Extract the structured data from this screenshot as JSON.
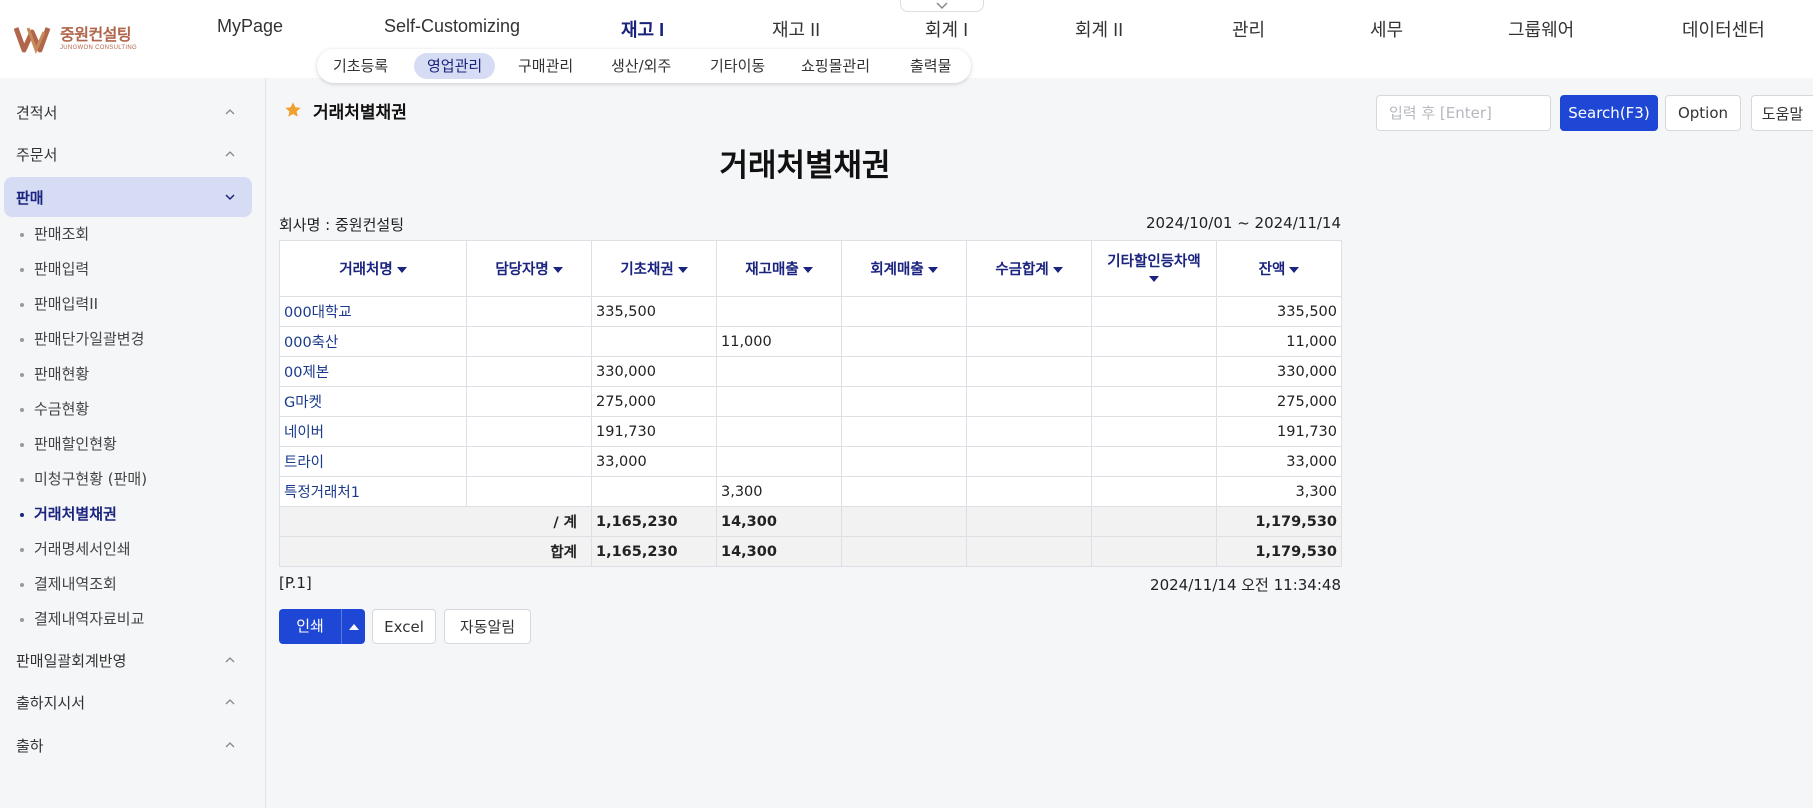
{
  "header": {
    "logo": {
      "text_ko": "중원컨설팅",
      "text_en": "JUNGWON CONSULTING",
      "icon": "jungwon-logo-mark"
    },
    "nav": [
      "MyPage",
      "Self-Customizing",
      "재고 I",
      "재고 II",
      "회계 I",
      "회계 II",
      "관리",
      "세무",
      "그룹웨어",
      "데이터센터"
    ],
    "active_nav": "재고 I",
    "subnav": [
      "기초등록",
      "영업관리",
      "구매관리",
      "생산/외주",
      "기타이동",
      "쇼핑몰관리",
      "출력물"
    ],
    "active_subnav": "영업관리"
  },
  "sidebar": {
    "groups_top": [
      "견적서",
      "주문서"
    ],
    "active_group": "판매",
    "items": [
      "판매조회",
      "판매입력",
      "판매입력II",
      "판매단가일괄변경",
      "판매현황",
      "수금현황",
      "판매할인현황",
      "미청구현황 (판매)",
      "거래처별채권",
      "거래명세서인쇄",
      "결제내역조회",
      "결제내역자료비교"
    ],
    "active_item": "거래처별채권",
    "groups_bottom": [
      "판매일괄회계반영",
      "출하지시서",
      "출하"
    ]
  },
  "page": {
    "title": "거래처별채권",
    "search_placeholder": "입력 후 [Enter]",
    "search_button": "Search(F3)",
    "option_button": "Option",
    "help_button": "도움말"
  },
  "report": {
    "title": "거래처별채권",
    "company": "회사명 : 중원컨설팅",
    "date_range": "2024/10/01 ~ 2024/11/14",
    "columns": [
      "거래처명",
      "담당자명",
      "기초채권",
      "재고매출",
      "회계매출",
      "수금합계",
      "기타할인등차액",
      "잔액"
    ],
    "rows": [
      {
        "name": "000대학교",
        "manager": "",
        "opening": "335,500",
        "inventory_sales": "",
        "accounting_sales": "",
        "collected": "",
        "other_diff": "",
        "balance": "335,500"
      },
      {
        "name": "000축산",
        "manager": "",
        "opening": "",
        "inventory_sales": "11,000",
        "accounting_sales": "",
        "collected": "",
        "other_diff": "",
        "balance": "11,000"
      },
      {
        "name": "00제본",
        "manager": "",
        "opening": "330,000",
        "inventory_sales": "",
        "accounting_sales": "",
        "collected": "",
        "other_diff": "",
        "balance": "330,000"
      },
      {
        "name": "G마켓",
        "manager": "",
        "opening": "275,000",
        "inventory_sales": "",
        "accounting_sales": "",
        "collected": "",
        "other_diff": "",
        "balance": "275,000"
      },
      {
        "name": "네이버",
        "manager": "",
        "opening": "191,730",
        "inventory_sales": "",
        "accounting_sales": "",
        "collected": "",
        "other_diff": "",
        "balance": "191,730"
      },
      {
        "name": "트라이",
        "manager": "",
        "opening": "33,000",
        "inventory_sales": "",
        "accounting_sales": "",
        "collected": "",
        "other_diff": "",
        "balance": "33,000"
      },
      {
        "name": "특정거래처1",
        "manager": "",
        "opening": "",
        "inventory_sales": "3,300",
        "accounting_sales": "",
        "collected": "",
        "other_diff": "",
        "balance": "3,300"
      }
    ],
    "subtotal": {
      "label": "/ 계",
      "opening": "1,165,230",
      "inventory_sales": "14,300",
      "balance": "1,179,530"
    },
    "total": {
      "label": "합계",
      "opening": "1,165,230",
      "inventory_sales": "14,300",
      "balance": "1,179,530"
    },
    "page_no": "[P.1]",
    "timestamp": "2024/11/14 오전 11:34:48"
  },
  "footer_buttons": {
    "print": "인쇄",
    "excel": "Excel",
    "auto_notify": "자동알림"
  },
  "colors": {
    "primary": "#1f47d6",
    "nav_active": "#1a237e",
    "highlight": "#d6dcf3",
    "star": "#f0a030"
  }
}
